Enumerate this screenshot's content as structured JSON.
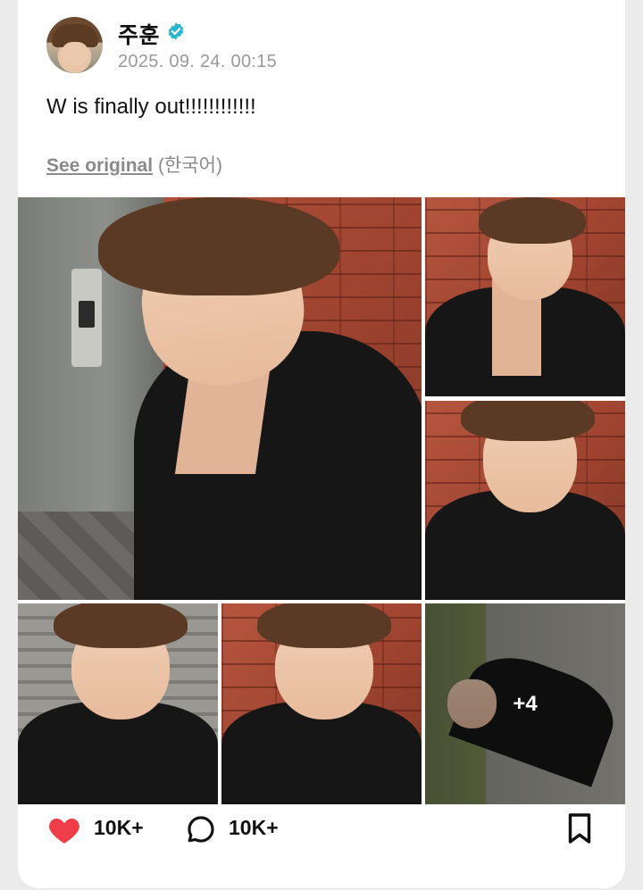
{
  "post": {
    "author": "주훈",
    "timestamp": "2025. 09. 24. 00:15",
    "text": "W is finally out!!!!!!!!!!!!",
    "see_original_label": "See original",
    "original_language": "(한국어)"
  },
  "media": {
    "more_count_label": "+4"
  },
  "actions": {
    "like_count": "10K+",
    "comment_count": "10K+"
  },
  "colors": {
    "verified_badge": "#29b6d0",
    "like_heart": "#ef3e4a",
    "meta_text": "#9a9a9a"
  },
  "icons": {
    "verified": "verified-badge-icon",
    "like": "heart-icon",
    "comment": "comment-bubble-icon",
    "bookmark": "bookmark-icon"
  }
}
